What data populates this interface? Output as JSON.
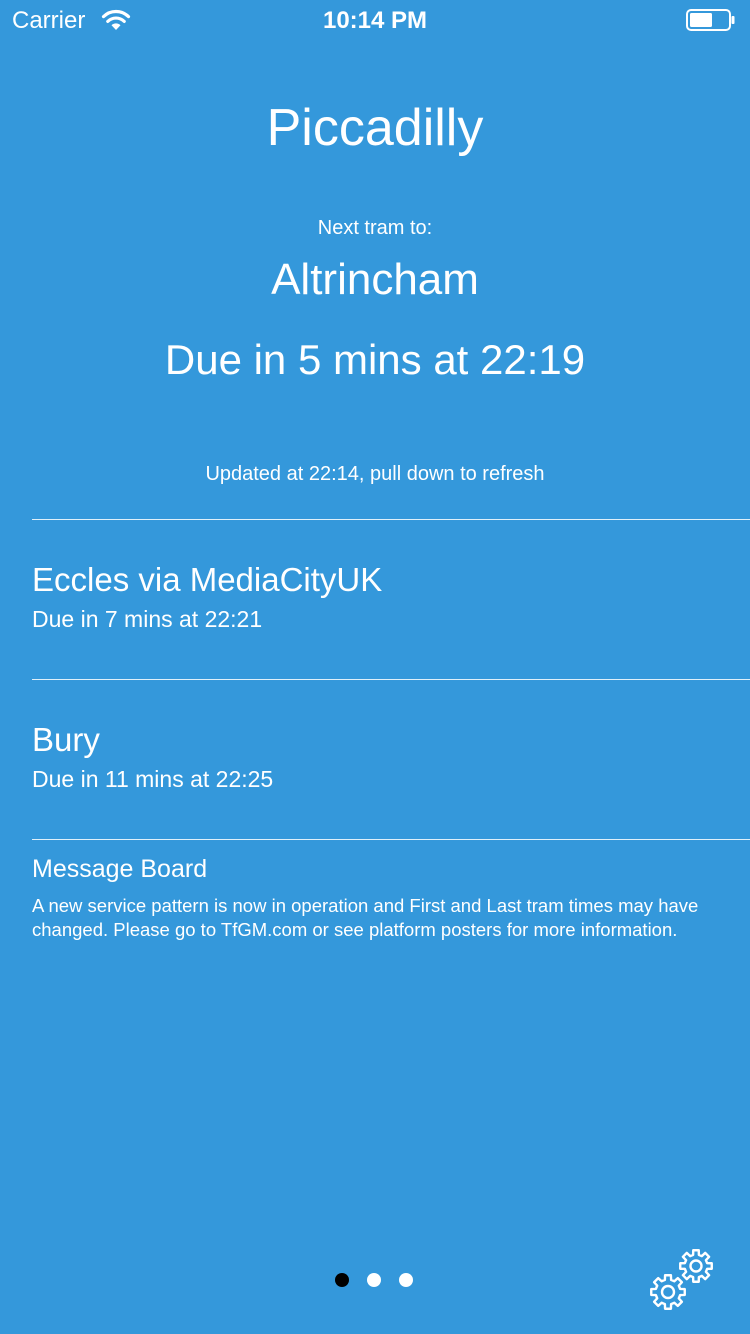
{
  "status_bar": {
    "carrier": "Carrier",
    "time": "10:14 PM"
  },
  "station": {
    "name": "Piccadilly"
  },
  "next_tram": {
    "label": "Next tram to:",
    "destination": "Altrincham",
    "due": "Due in 5 mins at 22:19"
  },
  "updated": "Updated at 22:14, pull down to refresh",
  "departures": [
    {
      "destination": "Eccles via MediaCityUK",
      "due": "Due in 7 mins at 22:21"
    },
    {
      "destination": "Bury",
      "due": "Due in 11 mins at 22:25"
    }
  ],
  "message_board": {
    "title": "Message Board",
    "text": "A new service pattern is now in operation and First and Last tram times may have changed. Please go to TfGM.com or see platform posters for more information."
  },
  "pager": {
    "pages": 3,
    "current": 1
  },
  "icons": {
    "wifi": "wifi-icon",
    "battery": "battery-icon",
    "settings": "gears-icon"
  },
  "colors": {
    "background": "#3498db",
    "text": "#ffffff",
    "active_dot": "#000000"
  }
}
